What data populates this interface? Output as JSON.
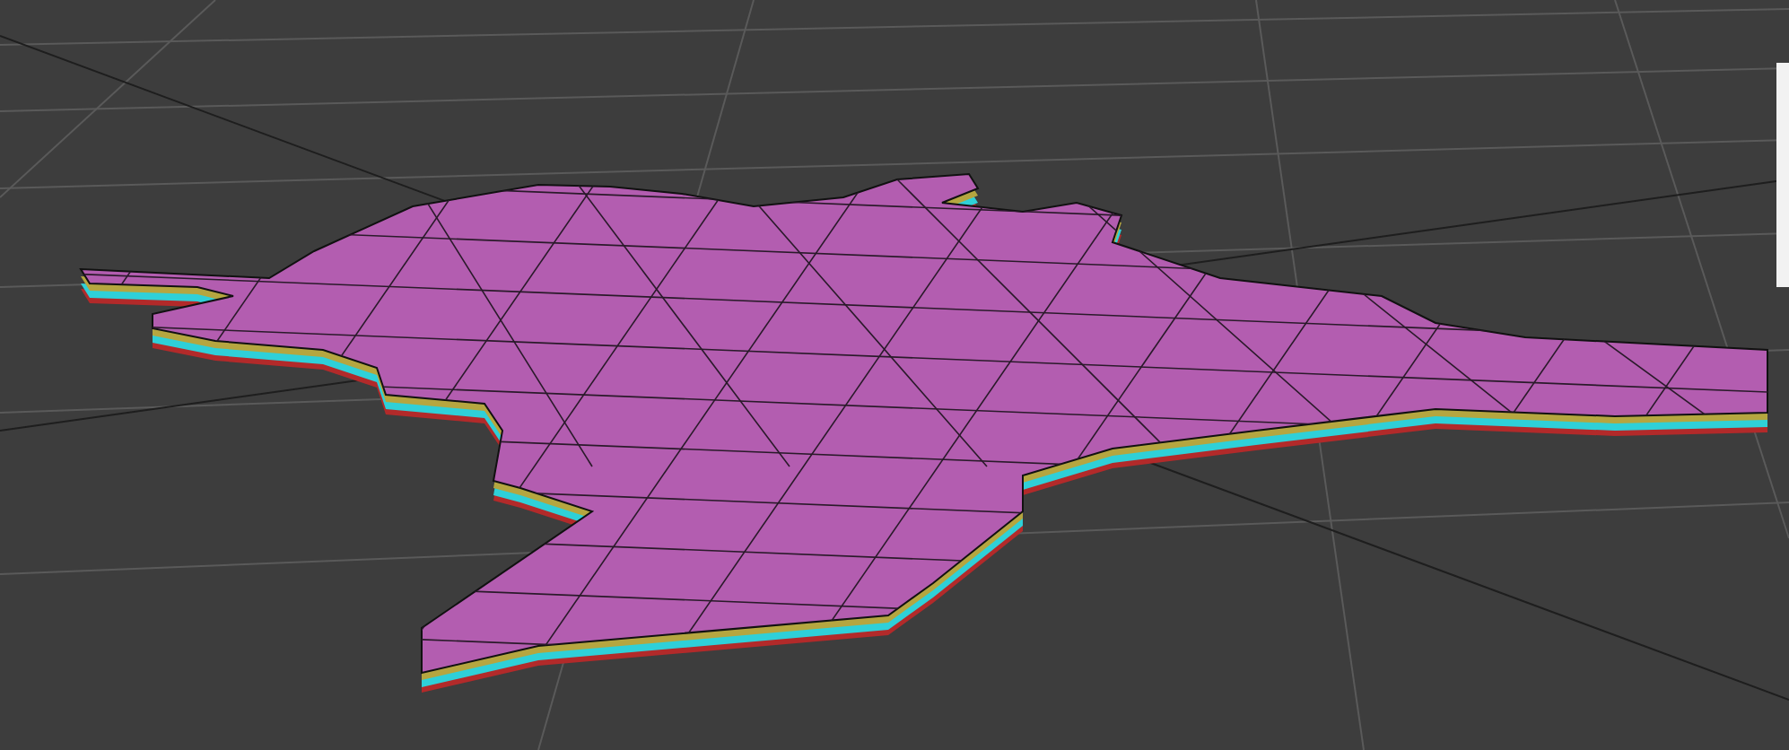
{
  "viewport": {
    "grid": true
  },
  "side_panel": {
    "visible": true
  }
}
